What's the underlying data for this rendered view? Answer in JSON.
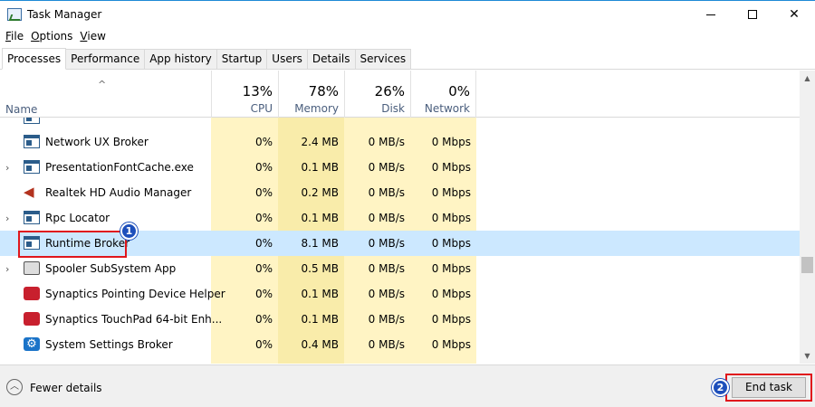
{
  "window": {
    "title": "Task Manager",
    "controls": [
      "minimize",
      "maximize",
      "close"
    ]
  },
  "menu": [
    {
      "label": "File",
      "accel": "F",
      "rest": "ile"
    },
    {
      "label": "Options",
      "accel": "O",
      "rest": "ptions"
    },
    {
      "label": "View",
      "accel": "V",
      "rest": "iew"
    }
  ],
  "tabs": [
    {
      "label": "Processes",
      "active": true
    },
    {
      "label": "Performance",
      "active": false
    },
    {
      "label": "App history",
      "active": false
    },
    {
      "label": "Startup",
      "active": false
    },
    {
      "label": "Users",
      "active": false
    },
    {
      "label": "Details",
      "active": false
    },
    {
      "label": "Services",
      "active": false
    }
  ],
  "columns": {
    "name": "Name",
    "cpu": {
      "pct": "13%",
      "label": "CPU"
    },
    "memory": {
      "pct": "78%",
      "label": "Memory"
    },
    "disk": {
      "pct": "26%",
      "label": "Disk"
    },
    "network": {
      "pct": "0%",
      "label": "Network"
    }
  },
  "rows": [
    {
      "name": "Network UX Broker",
      "icon": "window-icon",
      "expandable": false,
      "cpu": "0%",
      "memory": "2.4 MB",
      "disk": "0 MB/s",
      "network": "0 Mbps",
      "selected": false
    },
    {
      "name": "PresentationFontCache.exe",
      "icon": "window-icon",
      "expandable": true,
      "cpu": "0%",
      "memory": "0.1 MB",
      "disk": "0 MB/s",
      "network": "0 Mbps",
      "selected": false
    },
    {
      "name": "Realtek HD Audio Manager",
      "icon": "speaker-icon",
      "expandable": false,
      "cpu": "0%",
      "memory": "0.2 MB",
      "disk": "0 MB/s",
      "network": "0 Mbps",
      "selected": false
    },
    {
      "name": "Rpc Locator",
      "icon": "window-icon",
      "expandable": true,
      "cpu": "0%",
      "memory": "0.1 MB",
      "disk": "0 MB/s",
      "network": "0 Mbps",
      "selected": false
    },
    {
      "name": "Runtime Broker",
      "icon": "window-icon",
      "expandable": false,
      "cpu": "0%",
      "memory": "8.1 MB",
      "disk": "0 MB/s",
      "network": "0 Mbps",
      "selected": true
    },
    {
      "name": "Spooler SubSystem App",
      "icon": "printer-icon",
      "expandable": true,
      "cpu": "0%",
      "memory": "0.5 MB",
      "disk": "0 MB/s",
      "network": "0 Mbps",
      "selected": false
    },
    {
      "name": "Synaptics Pointing Device Helper",
      "icon": "synaptics-icon",
      "expandable": false,
      "cpu": "0%",
      "memory": "0.1 MB",
      "disk": "0 MB/s",
      "network": "0 Mbps",
      "selected": false
    },
    {
      "name": "Synaptics TouchPad 64-bit Enh...",
      "icon": "synaptics-icon",
      "expandable": false,
      "cpu": "0%",
      "memory": "0.1 MB",
      "disk": "0 MB/s",
      "network": "0 Mbps",
      "selected": false
    },
    {
      "name": "System Settings Broker",
      "icon": "gear-icon",
      "expandable": false,
      "cpu": "0%",
      "memory": "0.4 MB",
      "disk": "0 MB/s",
      "network": "0 Mbps",
      "selected": false
    }
  ],
  "footer": {
    "fewer_details": "Fewer details",
    "end_task": "End task"
  },
  "annotations": {
    "badge1": "1",
    "badge2": "2",
    "color": "#e0161c",
    "badge_color": "#1d4fbb"
  },
  "colors": {
    "cpu_column": "#fff4c4",
    "memory_column": "#f9ecaa",
    "selected_row": "#cce8ff"
  }
}
